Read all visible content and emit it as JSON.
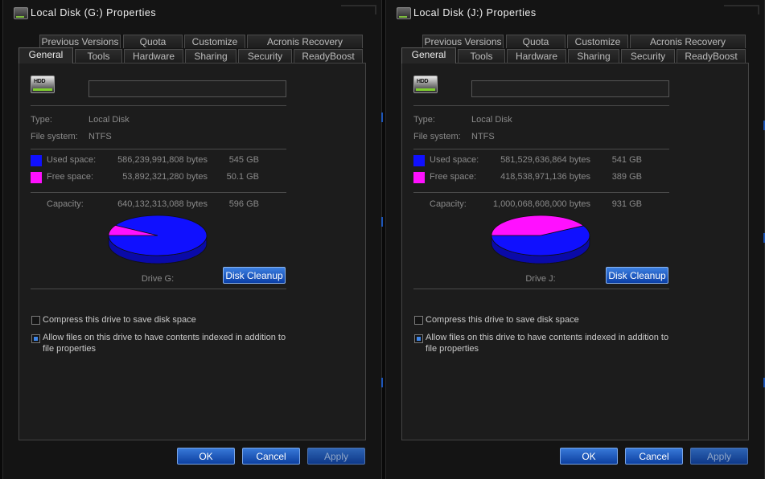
{
  "windows": [
    {
      "title": "Local Disk (G:) Properties",
      "tabs_top": [
        "Previous Versions",
        "Quota",
        "Customize",
        "Acronis Recovery"
      ],
      "tabs_bottom": [
        "General",
        "Tools",
        "Hardware",
        "Sharing",
        "Security",
        "ReadyBoost"
      ],
      "active_tab": "General",
      "icon_text": "HDD",
      "volume_name": "",
      "type_label": "Type:",
      "type_value": "Local Disk",
      "fs_label": "File system:",
      "fs_value": "NTFS",
      "used_label": "Used space:",
      "used_bytes": "586,239,991,808 bytes",
      "used_gb": "545 GB",
      "free_label": "Free space:",
      "free_bytes": "53,892,321,280 bytes",
      "free_gb": "50.1 GB",
      "capacity_label": "Capacity:",
      "capacity_bytes": "640,132,313,088 bytes",
      "capacity_gb": "596 GB",
      "drive_label": "Drive G:",
      "cleanup_label": "Disk Cleanup",
      "compress_label": "Compress this drive to save disk space",
      "compress_checked": false,
      "index_label_1": "Allow files on this drive to have contents indexed in addition to",
      "index_label_2": "file properties",
      "index_checked": true,
      "used_fraction": 0.916,
      "used_color": "#1010ff",
      "free_color": "#ff10ff",
      "ok_label": "OK",
      "cancel_label": "Cancel",
      "apply_label": "Apply"
    },
    {
      "title": "Local Disk (J:) Properties",
      "tabs_top": [
        "Previous Versions",
        "Quota",
        "Customize",
        "Acronis Recovery"
      ],
      "tabs_bottom": [
        "General",
        "Tools",
        "Hardware",
        "Sharing",
        "Security",
        "ReadyBoost"
      ],
      "active_tab": "General",
      "icon_text": "HDD",
      "volume_name": "",
      "type_label": "Type:",
      "type_value": "Local Disk",
      "fs_label": "File system:",
      "fs_value": "NTFS",
      "used_label": "Used space:",
      "used_bytes": "581,529,636,864 bytes",
      "used_gb": "541 GB",
      "free_label": "Free space:",
      "free_bytes": "418,538,971,136 bytes",
      "free_gb": "389 GB",
      "capacity_label": "Capacity:",
      "capacity_bytes": "1,000,068,608,000 bytes",
      "capacity_gb": "931 GB",
      "drive_label": "Drive J:",
      "cleanup_label": "Disk Cleanup",
      "compress_label": "Compress this drive to save disk space",
      "compress_checked": false,
      "index_label_1": "Allow files on this drive to have contents indexed in addition to",
      "index_label_2": "file properties",
      "index_checked": true,
      "used_fraction": 0.581,
      "used_color": "#1010ff",
      "free_color": "#ff10ff",
      "ok_label": "OK",
      "cancel_label": "Cancel",
      "apply_label": "Apply"
    }
  ]
}
